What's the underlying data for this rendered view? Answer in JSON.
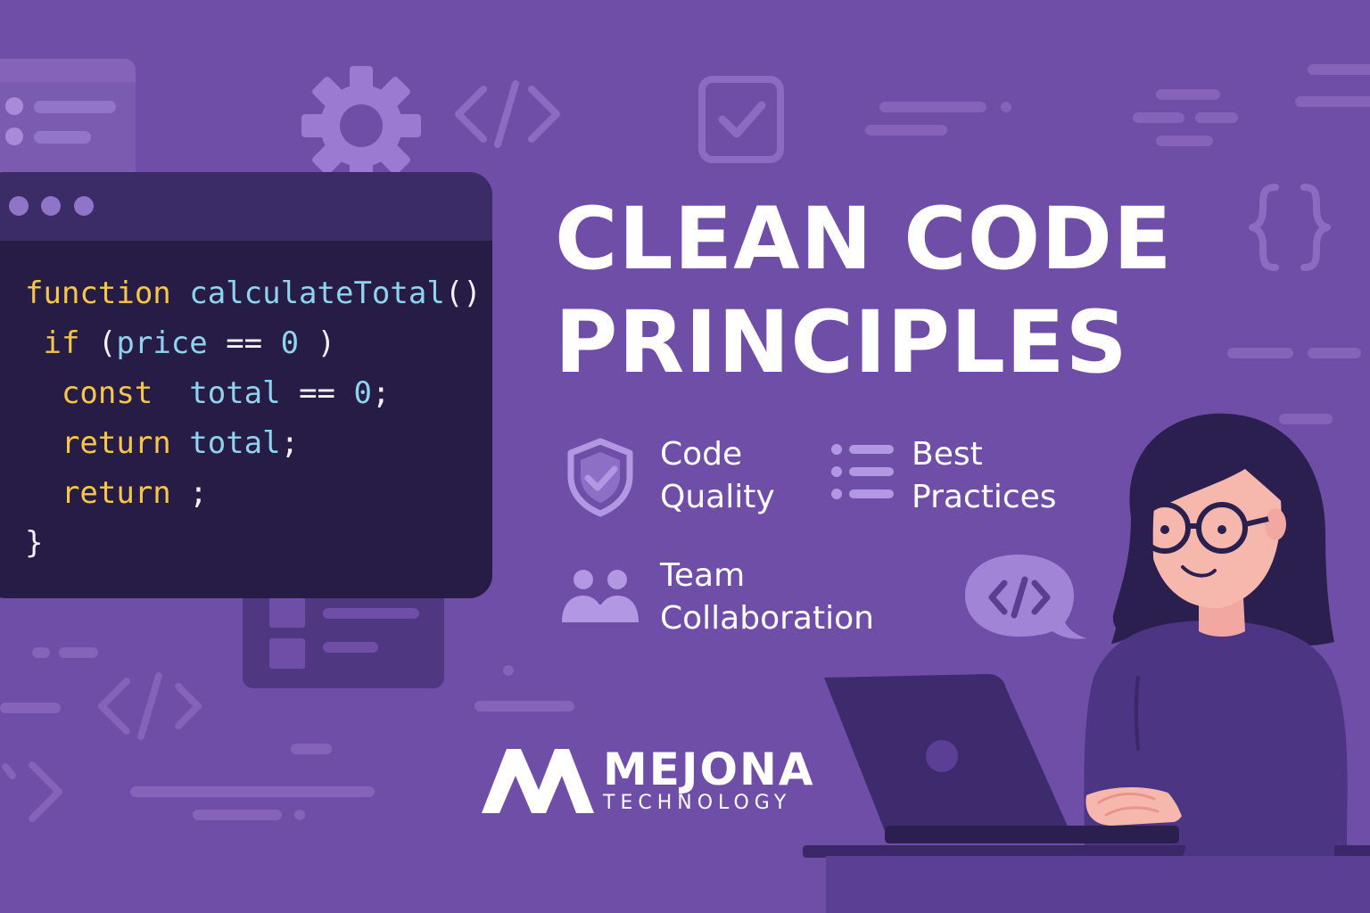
{
  "code_window": {
    "lines": [
      {
        "parts": [
          {
            "t": "function",
            "c": "kw"
          },
          {
            "t": " calculateTotal",
            "c": "fn"
          },
          {
            "t": "()",
            "c": "pl"
          }
        ]
      },
      {
        "parts": [
          {
            "t": " if",
            "c": "kw"
          },
          {
            "t": " (",
            "c": "pl"
          },
          {
            "t": "price",
            "c": "var"
          },
          {
            "t": " == ",
            "c": "pl"
          },
          {
            "t": "0",
            "c": "var"
          },
          {
            "t": " )",
            "c": "pl"
          }
        ]
      },
      {
        "parts": [
          {
            "t": "  const",
            "c": "kw"
          },
          {
            "t": "  total",
            "c": "var"
          },
          {
            "t": " == ",
            "c": "pl"
          },
          {
            "t": "0",
            "c": "var"
          },
          {
            "t": ";",
            "c": "pl"
          }
        ]
      },
      {
        "parts": [
          {
            "t": "  return",
            "c": "kw"
          },
          {
            "t": " total",
            "c": "var"
          },
          {
            "t": ";",
            "c": "pl"
          }
        ]
      },
      {
        "parts": [
          {
            "t": "  return",
            "c": "kw"
          },
          {
            "t": " ;",
            "c": "pl"
          }
        ]
      },
      {
        "parts": [
          {
            "t": "}",
            "c": "pl"
          }
        ]
      }
    ]
  },
  "title": {
    "line1": "CLEAN CODE",
    "line2": "PRINCIPLES"
  },
  "features": {
    "code_quality": {
      "line1": "Code",
      "line2": "Quality",
      "icon": "shield-check-icon"
    },
    "best_practices": {
      "line1": "Best",
      "line2": "Practices",
      "icon": "list-icon"
    },
    "team_collaboration": {
      "line1": "Team",
      "line2": "Collaboration",
      "icon": "team-icon"
    }
  },
  "logo": {
    "name": "MEJONA",
    "subtitle": "TECHNOLOGY"
  },
  "colors": {
    "background": "#6e4ea6",
    "code_bg": "#261c45",
    "keyword": "#f6c54b",
    "identifier": "#8fd3ef",
    "accent": "#a98ad9"
  }
}
